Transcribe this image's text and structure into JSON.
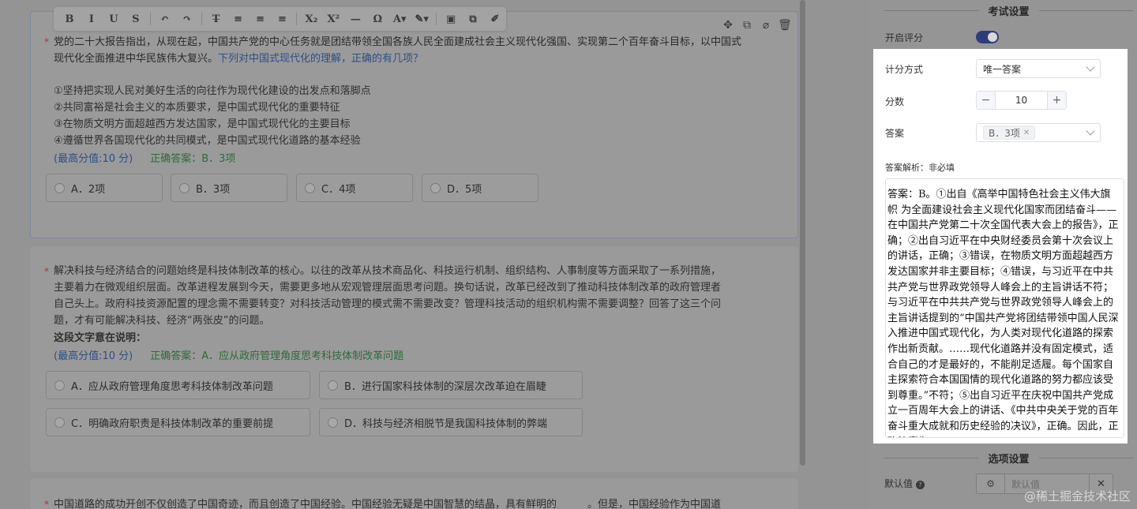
{
  "toolbar": {
    "items": [
      {
        "name": "bold",
        "glyph": "B"
      },
      {
        "name": "italic",
        "glyph": "I"
      },
      {
        "name": "underline",
        "glyph": "U"
      },
      {
        "name": "strikethrough",
        "glyph": "S"
      },
      {
        "name": "undo",
        "glyph": "↶"
      },
      {
        "name": "redo",
        "glyph": "↷"
      },
      {
        "name": "clear-format",
        "glyph": "T̶"
      },
      {
        "name": "align-left",
        "glyph": "≡"
      },
      {
        "name": "align-center",
        "glyph": "≡"
      },
      {
        "name": "align-right",
        "glyph": "≡"
      },
      {
        "name": "subscript",
        "glyph": "X₂"
      },
      {
        "name": "superscript",
        "glyph": "X²"
      },
      {
        "name": "horizontal-rule",
        "glyph": "—"
      },
      {
        "name": "special-char",
        "glyph": "Ω"
      },
      {
        "name": "font-color",
        "glyph": "A▾"
      },
      {
        "name": "highlight",
        "glyph": "✎▾"
      },
      {
        "name": "image",
        "glyph": "▣"
      },
      {
        "name": "copy",
        "glyph": "⧉"
      },
      {
        "name": "edit",
        "glyph": "✐"
      }
    ]
  },
  "card_tools": [
    "✥",
    "⧉",
    "⌀",
    "🗑"
  ],
  "questions": [
    {
      "stem_plain": "党的二十大报告指出，从现在起，中国共产党的中心任务就是团结带领全国各族人民全面建成社会主义现代化强国、实现第二个百年奋斗目标，以中国式现代化全面推进中华民族伟大复兴。",
      "stem_highlight": "下列对中国式现代化的理解，正确的有几项？",
      "statements": [
        "①坚持把实现人民对美好生活的向往作为现代化建设的出发点和落脚点",
        "②共同富裕是社会主义的本质要求，是中国式现代化的重要特征",
        "③在物质文明方面超越西方发达国家，是中国式现代化的主要目标",
        "④遵循世界各国现代化的共同模式，是中国式现代化道路的基本经验"
      ],
      "max_score": "(最高分值:10 分)",
      "correct": "正确答案：B．3项",
      "options": [
        "A．2项",
        "B．3项",
        "C．4项",
        "D．5项"
      ]
    },
    {
      "stem_lines": [
        "解决科技与经济结合的问题始终是科技体制改革的核心。以往的改革从技术商品化、科技运行机制、组织结构、人事制度等方面采取了一系列措施，",
        "主要着力在微观组织层面。改革进程发展到今天，需要更多地从宏观管理层面思考问题。换句话说，改革已经改到了推动科技体制改革的政府管理者",
        "自己头上。政府科技资源配置的理念需不需要转变？对科技活动管理的模式需不需要改变？管理科技活动的组织机构需不需要调整？回答了这三个问",
        "题，才有可能解决科技、经济“两张皮”的问题。"
      ],
      "prompt": "这段文字意在说明：",
      "max_score": "(最高分值:10 分)",
      "correct": "正确答案：A．应从政府管理角度思考科技体制改革问题",
      "options": [
        "A．应从政府管理角度思考科技体制改革问题",
        "B．进行国家科技体制的深层次改革迫在眉睫",
        "C．明确政府职责是科技体制改革的重要前提",
        "D．科技与经济相脱节是我国科技体制的弊端"
      ]
    },
    {
      "stem_partial": "中国道路的成功开创不仅创造了中国奇迹，而且创造了中国经验。中国经验无疑是中国智慧的结晶，具有鲜明的______。但是，中国经验作为中国道"
    }
  ],
  "panel": {
    "exam_settings_title": "考试设置",
    "enable_scoring_label": "开启评分",
    "enable_scoring_on": true,
    "scoring_method_label": "计分方式",
    "scoring_method_value": "唯一答案",
    "score_label": "分数",
    "score_value": "10",
    "answer_label": "答案",
    "answer_tag": "B．3项",
    "analysis_label": "答案解析：非必填",
    "analysis_text": "答案：B。①出自《高举中国特色社会主义伟大旗帜 为全面建设社会主义现代化国家而团结奋斗——在中国共产党第二十次全国代表大会上的报告》，正确；②出自习近平在中央财经委员会第十次会议上的讲话，正确；③错误，在物质文明方面超越西方发达国家并非主要目标；④错误，与习近平在中共共产党与世界政党领导人峰会上的主旨讲话不符；与习近平在中共共产党与世界政党领导人峰会上的主旨讲话提到的“中国共产党将团结带领中国人民深入推进中国式现代化，为人类对现代化道路的探索作出新贡献。……现代化道路并没有固定模式，适合自己的才是最好的，不能削足适履。每个国家自主探索符合本国国情的现代化道路的努力都应该受到尊重。”不符；⑤出自习近平在庆祝中国共产党成立一百周年大会上的讲话、《中共中央关于党的百年奋斗重大成就和历史经验的决议》，正确。因此，正确答案为B。",
    "option_settings_title": "选项设置",
    "default_value_label": "默认值",
    "default_value_placeholder": "默认值"
  },
  "watermark": "@稀土掘金技术社区"
}
